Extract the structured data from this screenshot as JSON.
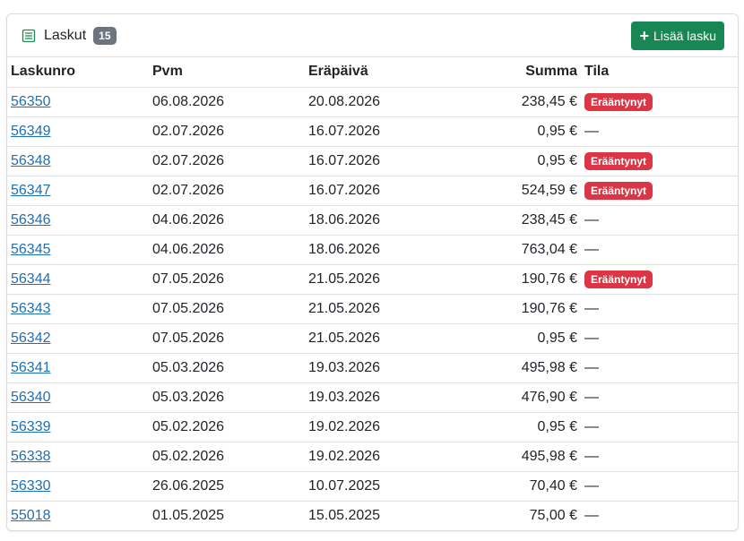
{
  "header": {
    "title": "Laskut",
    "count": "15",
    "add_button_label": "Lisää lasku",
    "add_button_icon": "plus-icon",
    "title_icon": "list-icon"
  },
  "colors": {
    "primary_button": "#198754",
    "overdue_badge": "#dc3545",
    "count_badge": "#6c757d",
    "link": "#1f6fb5"
  },
  "table": {
    "columns": [
      "Laskunro",
      "Pvm",
      "Eräpäivä",
      "Summa",
      "Tila"
    ],
    "rows": [
      {
        "number": "56350",
        "date": "06.08.2026",
        "due": "20.08.2026",
        "sum": "238,45 €",
        "status": "Erääntynyt"
      },
      {
        "number": "56349",
        "date": "02.07.2026",
        "due": "16.07.2026",
        "sum": "0,95 €",
        "status": "—"
      },
      {
        "number": "56348",
        "date": "02.07.2026",
        "due": "16.07.2026",
        "sum": "0,95 €",
        "status": "Erääntynyt"
      },
      {
        "number": "56347",
        "date": "02.07.2026",
        "due": "16.07.2026",
        "sum": "524,59 €",
        "status": "Erääntynyt"
      },
      {
        "number": "56346",
        "date": "04.06.2026",
        "due": "18.06.2026",
        "sum": "238,45 €",
        "status": "—"
      },
      {
        "number": "56345",
        "date": "04.06.2026",
        "due": "18.06.2026",
        "sum": "763,04 €",
        "status": "—"
      },
      {
        "number": "56344",
        "date": "07.05.2026",
        "due": "21.05.2026",
        "sum": "190,76 €",
        "status": "Erääntynyt"
      },
      {
        "number": "56343",
        "date": "07.05.2026",
        "due": "21.05.2026",
        "sum": "190,76 €",
        "status": "—"
      },
      {
        "number": "56342",
        "date": "07.05.2026",
        "due": "21.05.2026",
        "sum": "0,95 €",
        "status": "—"
      },
      {
        "number": "56341",
        "date": "05.03.2026",
        "due": "19.03.2026",
        "sum": "495,98 €",
        "status": "—"
      },
      {
        "number": "56340",
        "date": "05.03.2026",
        "due": "19.03.2026",
        "sum": "476,90 €",
        "status": "—"
      },
      {
        "number": "56339",
        "date": "05.02.2026",
        "due": "19.02.2026",
        "sum": "0,95 €",
        "status": "—"
      },
      {
        "number": "56338",
        "date": "05.02.2026",
        "due": "19.02.2026",
        "sum": "495,98 €",
        "status": "—"
      },
      {
        "number": "56330",
        "date": "26.06.2025",
        "due": "10.07.2025",
        "sum": "70,40 €",
        "status": "—"
      },
      {
        "number": "55018",
        "date": "01.05.2025",
        "due": "15.05.2025",
        "sum": "75,00 €",
        "status": "—"
      }
    ]
  }
}
